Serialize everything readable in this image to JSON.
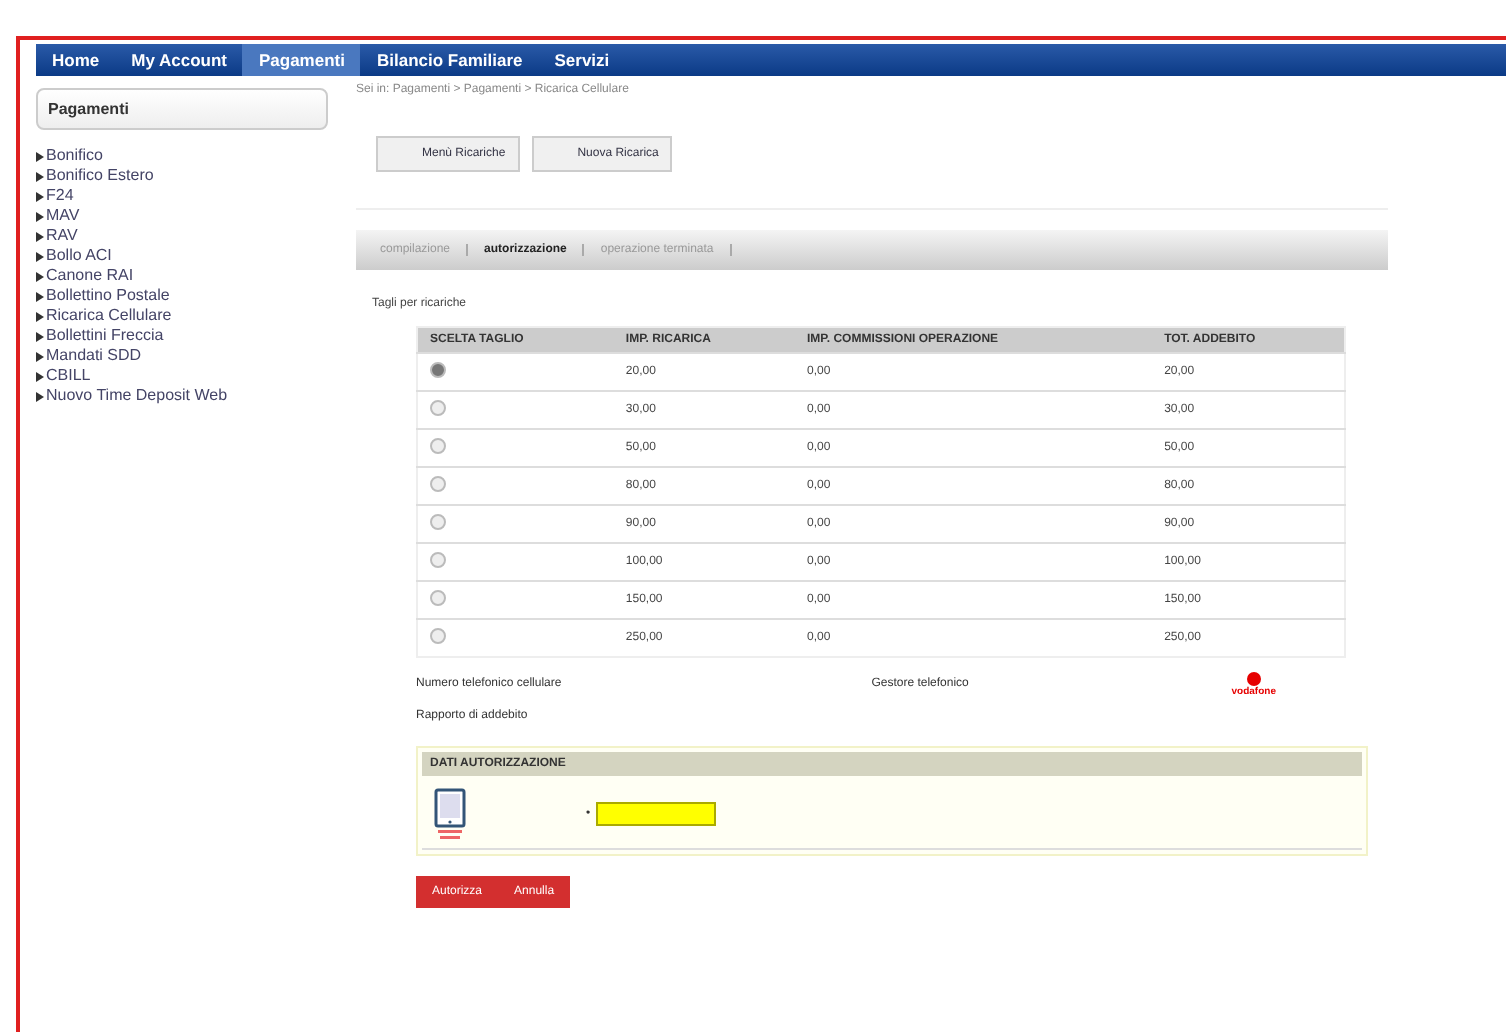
{
  "nav": [
    {
      "label": "Home",
      "selected": false
    },
    {
      "label": "My Account",
      "selected": false
    },
    {
      "label": "Pagamenti",
      "selected": true
    },
    {
      "label": "Bilancio Familiare",
      "selected": false
    },
    {
      "label": "Servizi",
      "selected": false
    }
  ],
  "sidebar": {
    "title": "Pagamenti",
    "items": [
      "Bonifico",
      "Bonifico Estero",
      "F24",
      "MAV",
      "RAV",
      "Bollo ACI",
      "Canone RAI",
      "Bollettino Postale",
      "Ricarica Cellulare",
      "Bollettini Freccia",
      "Mandati SDD",
      "CBILL",
      "Nuovo Time Deposit Web"
    ]
  },
  "breadcrumb": "Sei in: Pagamenti > Pagamenti > Ricarica Cellulare",
  "toolbar": [
    "Menù Ricariche",
    "Nuova Ricarica"
  ],
  "steps": [
    {
      "label": "compilazione",
      "selected": false
    },
    {
      "label": "autorizzazione",
      "selected": true
    },
    {
      "label": "operazione terminata",
      "selected": false
    }
  ],
  "section_label": "Tagli per ricariche",
  "table": {
    "columns": [
      "SCELTA TAGLIO",
      "IMP. RICARICA",
      "IMP. COMMISSIONI OPERAZIONE",
      "TOT. ADDEBITO"
    ],
    "rows": [
      {
        "selected": true,
        "cells": [
          "",
          "20,00",
          "0,00",
          "20,00"
        ]
      },
      {
        "selected": false,
        "cells": [
          "",
          "30,00",
          "0,00",
          "30,00"
        ]
      },
      {
        "selected": false,
        "cells": [
          "",
          "50,00",
          "0,00",
          "50,00"
        ]
      },
      {
        "selected": false,
        "cells": [
          "",
          "80,00",
          "0,00",
          "80,00"
        ]
      },
      {
        "selected": false,
        "cells": [
          "",
          "90,00",
          "0,00",
          "90,00"
        ]
      },
      {
        "selected": false,
        "cells": [
          "",
          "100,00",
          "0,00",
          "100,00"
        ]
      },
      {
        "selected": false,
        "cells": [
          "",
          "150,00",
          "0,00",
          "150,00"
        ]
      },
      {
        "selected": false,
        "cells": [
          "",
          "250,00",
          "0,00",
          "250,00"
        ]
      }
    ]
  },
  "phone_label": "Numero telefonico cellulare",
  "operator_label": "Gestore telefonico",
  "operator_logo": "vodafone",
  "debit_label": "Rapporto di addebito",
  "auth": {
    "title": "DATI AUTORIZZAZIONE",
    "bullet": "•"
  },
  "actions": [
    "Autorizza",
    "Annulla"
  ]
}
